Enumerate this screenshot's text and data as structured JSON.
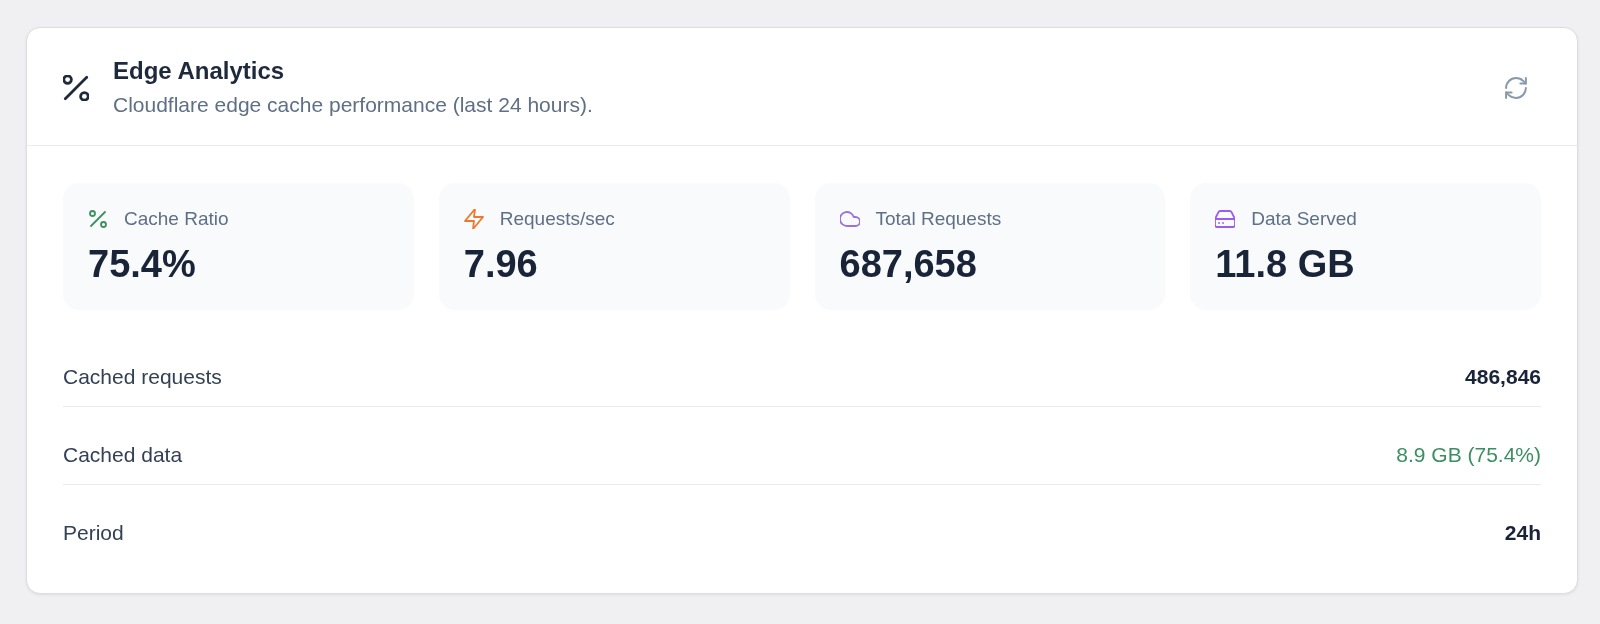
{
  "header": {
    "title": "Edge Analytics",
    "subtitle": "Cloudflare edge cache performance (last 24 hours)."
  },
  "stats": [
    {
      "kind": "percent",
      "label": "Cache Ratio",
      "value": "75.4%"
    },
    {
      "kind": "bolt",
      "label": "Requests/sec",
      "value": "7.96"
    },
    {
      "kind": "cloud",
      "label": "Total Requests",
      "value": "687,658"
    },
    {
      "kind": "drive",
      "label": "Data Served",
      "value": "11.8 GB"
    }
  ],
  "details": [
    {
      "kind": "emphasis",
      "label": "Cached requests",
      "value": "486,846"
    },
    {
      "kind": "positive",
      "label": "Cached data",
      "value": "8.9 GB (75.4%)"
    },
    {
      "kind": "emphasis",
      "label": "Period",
      "value": "24h"
    }
  ]
}
